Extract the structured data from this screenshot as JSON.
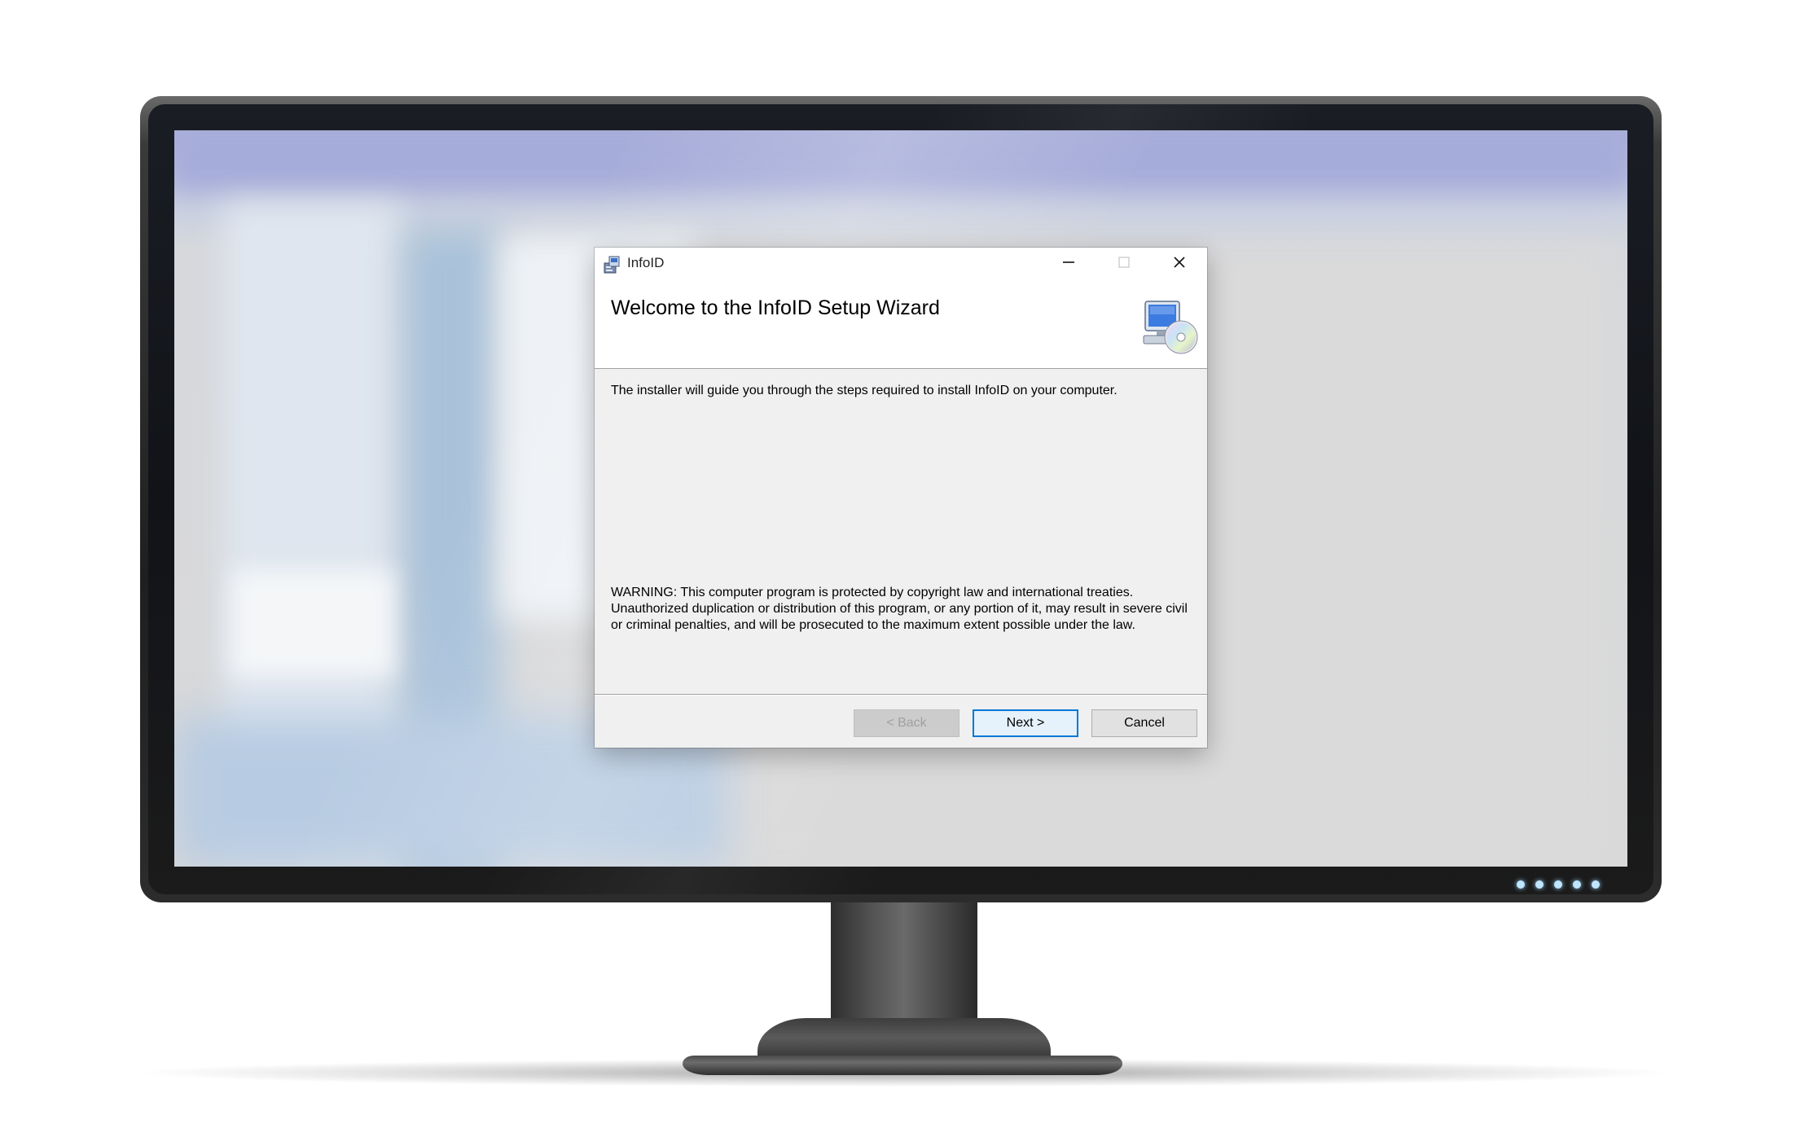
{
  "dialog": {
    "title": "InfoID",
    "heading": "Welcome to the InfoID Setup Wizard",
    "intro": "The installer will guide you through the steps required to install InfoID on your computer.",
    "warning": "WARNING: This computer program is protected by copyright law and international treaties. Unauthorized duplication or distribution of this program, or any portion of it, may result in severe civil or criminal penalties, and will be prosecuted to the maximum extent possible under the law.",
    "buttons": {
      "back": "< Back",
      "next": "Next >",
      "cancel": "Cancel"
    },
    "controls": [
      "minimize-icon",
      "maximize-icon",
      "close-icon"
    ]
  },
  "icons": [
    "installer-app-icon",
    "computer-cd-icon"
  ],
  "colors": {
    "accent": "#0078d7",
    "dialog_bg": "#f0f0f0",
    "header_bg": "#ffffff",
    "led": "#bfe6ff"
  }
}
